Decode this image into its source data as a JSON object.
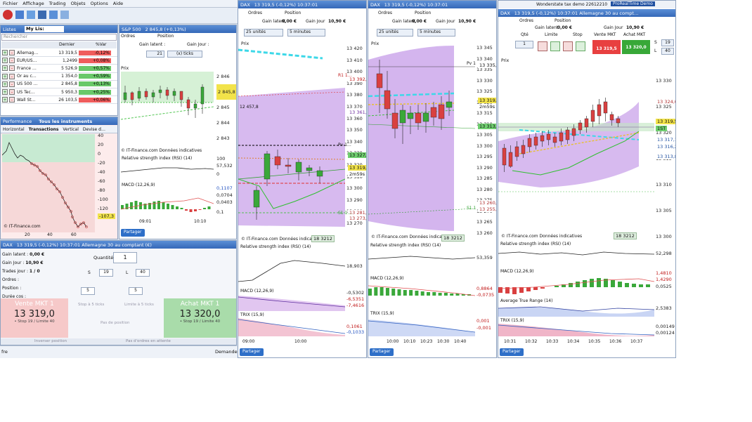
{
  "menu": [
    "Fichier",
    "Affichage",
    "Trading",
    "Objets",
    "Options",
    "Aide"
  ],
  "watchlist": {
    "title": "Listes",
    "list_name": "My Lis:",
    "search_placeholder": "Rechercher",
    "col_last": "Dernier",
    "col_var": "%Var",
    "rows": [
      {
        "name": "Allemag…",
        "last": "13 319,5",
        "var": "-0,12%",
        "dir": "neg"
      },
      {
        "name": "EUR/US…",
        "last": "1,2499",
        "var": "+0,08%",
        "dir": "neg"
      },
      {
        "name": "France …",
        "last": "5 526,9",
        "var": "+0,57%",
        "dir": "pos"
      },
      {
        "name": "Or au c…",
        "last": "1 354,0",
        "var": "+0,59%",
        "dir": "pos"
      },
      {
        "name": "US 500 …",
        "last": "2 845,8",
        "var": "+0,13%",
        "dir": "pos"
      },
      {
        "name": "US Tec…",
        "last": "5 950,3",
        "var": "+0,25%",
        "dir": "pos"
      },
      {
        "name": "Wall St…",
        "last": "26 103,5",
        "var": "+0,06%",
        "dir": "neg"
      }
    ]
  },
  "performance": {
    "title": "Performance",
    "subtitle": "Tous les instruments",
    "tabs": [
      "Horizontal",
      "Transactions",
      "Vertical",
      "Devise d…"
    ],
    "y_ticks": [
      "40",
      "20",
      "0",
      "-20",
      "-40",
      "-60",
      "-80",
      "-100",
      "-120"
    ],
    "x_ticks": [
      "20",
      "40",
      "60"
    ],
    "value_tag": "-107,3",
    "credit": "© IT-Finance.com"
  },
  "sp_chart": {
    "title": "S&P 500",
    "quote": "2 845,8 (+0,13%)",
    "order_label": "Ordres",
    "position_label": "Position",
    "gain_label": "Gain latent :",
    "gain_day": "Gain Jour :",
    "units": "21",
    "timeframe": "(x) ticks",
    "price_tag": "Prix",
    "y_ticks": [
      "2 846",
      "2 845,8",
      "2 845",
      "2 844",
      "2 843"
    ],
    "rsi": "Relative strength index (RSI) (14)",
    "rsi_val": "57,532",
    "rsi_top": "100",
    "rsi_bot": "0",
    "macd": "MACD (12,26,9)",
    "macd_vals": [
      "0,1107",
      "0,0704",
      "0,0403",
      "0,1"
    ],
    "x_ticks": [
      "09:01",
      "10:10"
    ],
    "credit": "© IT-Finance.com Données indicatives",
    "share": "Partager"
  },
  "dax_chart1": {
    "title": "DAX",
    "quote": "13 319,5 (-0,12%) 10:37:01",
    "orders": "Ordres",
    "position": "Position",
    "gain": "Gain latent",
    "gain_val": "0,00 €",
    "gain_day": "Gain Jour",
    "gain_day_val": "10,90 €",
    "units": "25 unités",
    "timeframe": "5 minutes",
    "prix": "Prix",
    "y_ticks": [
      "13 420",
      "13 410",
      "13 400",
      "13 390",
      "13 380",
      "13 370",
      "13 360",
      "13 350",
      "13 340",
      "13 330",
      "13 320",
      "13 310",
      "13 300",
      "13 290",
      "13 280",
      "13 270"
    ],
    "labels": {
      "r1": "R1 1…",
      "s1": "S1 1…",
      "pv": "Pv 1…",
      "ema": "12 457,8"
    },
    "tags": {
      "price": "13 319,5",
      "countdown": "2m59s",
      "t1": "13 333,4",
      "t2": "13 327,0",
      "t3": "13 392,5",
      "t4": "13 361,1",
      "t5": "13 281,2",
      "t6": "13 273,0"
    },
    "rsi": "Relative strength index (RSI) (14)",
    "rsi_val": "18,903",
    "macd": "MACD (12,26,9)",
    "macd_vals": [
      "-0,5302",
      "-6,5351",
      "-7,4616"
    ],
    "trix": "TRIX (15,9)",
    "trix_vals": [
      "0,1061",
      "-0,1033"
    ],
    "x_ticks": [
      "09:00",
      "10:00"
    ],
    "credit": "© IT-Finance.com Données indicatives",
    "counter": "18 3212",
    "share": "Partager"
  },
  "dax_chart2": {
    "title": "DAX",
    "quote": "13 319,5 (-0,12%) 10:37:01",
    "orders": "Ordres",
    "position": "Position",
    "gain": "Gain latent",
    "gain_val": "0,00 €",
    "gain_day": "Gain Jour",
    "gain_day_val": "10,90 €",
    "units": "25 unités",
    "timeframe": "5 minutes",
    "prix": "Prix",
    "y_ticks": [
      "13 345",
      "13 340",
      "13 335",
      "13 330",
      "13 325",
      "13 320",
      "13 315",
      "13 310",
      "13 305",
      "13 300",
      "13 295",
      "13 290",
      "13 285",
      "13 280",
      "13 275",
      "13 270",
      "13 265",
      "13 260"
    ],
    "tags": {
      "price": "13 319,5",
      "countdown": "2m59s",
      "pv": "Pv 1",
      "s1": "S1 1",
      "t1": "13 335,0",
      "t2": "13 313,0",
      "t3": "13 260,1",
      "t4": "13 255,9"
    },
    "rsi": "Relative strength index (RSI) (14)",
    "rsi_val": "53,359",
    "macd": "MACD (12,26,9)",
    "macd_vals": [
      "0,8864",
      "-0,0735"
    ],
    "trix": "TRIX (15,9)",
    "trix_vals": [
      "0,001",
      "-0,001"
    ],
    "x_ticks": [
      "10:00",
      "10:10",
      "10:23",
      "10:30",
      "10:40"
    ],
    "credit": "© IT-Finance.com Données indicatives",
    "counter": "18 3212",
    "share": "Partager"
  },
  "dax_chart3": {
    "window_title": "Wonderstate tax demo 22612210",
    "brand": "ProRealTime Demo",
    "title": "DAX",
    "quote": "13 319,5 (-0,12%) 10:37:01 Allemagne 30 au compt…",
    "orders": "Ordres",
    "position": "Position",
    "gain": "Gain latent",
    "gain_val": "0,00 €",
    "gain_day": "Gain Jour",
    "gain_day_val": "10,90 €",
    "qty_label": "Qté",
    "qty": "1",
    "limit_label": "Limite",
    "stop_label": "Stop",
    "sell_label": "Vente MKT",
    "buy_label": "Achat MKT",
    "sell_price": "13 319",
    "sell_suffix": ",5",
    "buy_price": "13 320",
    "buy_suffix": ",0",
    "s_label": "S",
    "l_label": "L",
    "s_val": "19",
    "l_val": "40",
    "prix": "Prix",
    "y_ticks": [
      "13 330",
      "13 325",
      "13 320",
      "13 315",
      "13 310",
      "13 305",
      "13 300"
    ],
    "tags": {
      "price": "13 319,5",
      "t1": "13 324,0",
      "t2": "13 317,1",
      "t3": "13 316,2",
      "t4": "13 313,8",
      "tag1": "1ST"
    },
    "rsi": "Relative strength index (RSI) (14)",
    "rsi_val": "52,298",
    "macd": "MACD (12,26,9)",
    "macd_vals": [
      "1,4810",
      "1,4290",
      "0,0525"
    ],
    "atr": "Average True Range (14)",
    "atr_val": "2,5383",
    "trix": "TRIX (15,9)",
    "trix_vals": [
      "0,00149",
      "0,00124"
    ],
    "x_ticks": [
      "10:31",
      "10:32",
      "10:33",
      "10:34",
      "10:35",
      "10:36",
      "10:37"
    ],
    "credit": "© IT-Finance.com Données indicatives",
    "counter": "18 3212",
    "share": "Partager"
  },
  "ticket": {
    "title": "DAX",
    "quote": "13 319,5 (-0,12%) 10:37:01 Allemagne 30 au comptant (€)",
    "gain_latent": "Gain latent :",
    "gain_latent_val": "0,00 €",
    "gain_jour": "Gain Jour :",
    "gain_jour_val": "10,90 €",
    "trades_jour": "Trades jour :",
    "trades_val": "1 / 0",
    "orders": "Ordres :",
    "position": "Position :",
    "duration": "Durée cos :",
    "quantite": "Quantité",
    "qty": "1",
    "s_label": "S",
    "l_label": "L",
    "s_val": "19",
    "l_val": "40",
    "small1": "5",
    "small2": "5",
    "stop_ticks": "Stop à 5 ticks",
    "limit_ticks": "Limite à 5 ticks",
    "no_position": "Pas de position",
    "sell_label": "Vente MKT 1",
    "sell_price": "13 319,0",
    "sell_sub": "• Stop 19 / Limite 40",
    "buy_label": "Achat MKT 1",
    "buy_price": "13 320,0",
    "buy_sub": "• Stop 19 / Limite 40",
    "invert": "Inverser position",
    "no_orders": "Pas d'ordres en attente"
  },
  "statusbar": {
    "left": "fre",
    "right": "Demande"
  },
  "colors": {
    "bull": "#3aa83a",
    "bear": "#d94040",
    "cloud": "#c9a3ea",
    "accent": "#2e6fc8"
  }
}
